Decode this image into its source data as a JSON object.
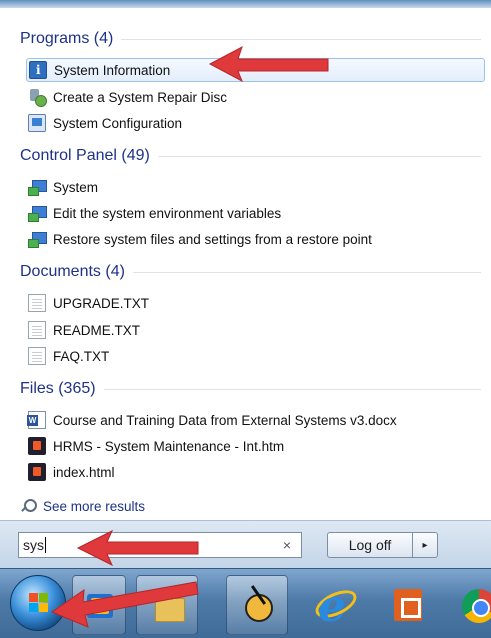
{
  "groups": {
    "programs": {
      "header": "Programs (4)",
      "items": [
        {
          "label": "System Information",
          "icon": "system-information-icon"
        },
        {
          "label": "Create a System Repair Disc",
          "icon": "repair-disc-icon"
        },
        {
          "label": "System Configuration",
          "icon": "system-configuration-icon"
        }
      ]
    },
    "control_panel": {
      "header": "Control Panel (49)",
      "items": [
        {
          "label": "System",
          "icon": "control-panel-icon"
        },
        {
          "label": "Edit the system environment variables",
          "icon": "control-panel-icon"
        },
        {
          "label": "Restore system files and settings from a restore point",
          "icon": "control-panel-icon"
        }
      ]
    },
    "documents": {
      "header": "Documents (4)",
      "items": [
        {
          "label": "UPGRADE.TXT",
          "icon": "text-file-icon"
        },
        {
          "label": "README.TXT",
          "icon": "text-file-icon"
        },
        {
          "label": "FAQ.TXT",
          "icon": "text-file-icon"
        }
      ]
    },
    "files": {
      "header": "Files (365)",
      "items": [
        {
          "label": "Course and Training Data from External Systems v3.docx",
          "icon": "word-document-icon"
        },
        {
          "label": "HRMS - System Maintenance - Int.htm",
          "icon": "html-file-icon"
        },
        {
          "label": "index.html",
          "icon": "html-file-icon"
        }
      ]
    }
  },
  "see_more": "See more results",
  "search": {
    "value": "sys",
    "clear": "×"
  },
  "logoff": {
    "label": "Log off",
    "arrow": "▸"
  },
  "colors": {
    "header_text": "#1e3287",
    "selection_border": "#9dc2ea",
    "annotation_arrow": "#e0393b",
    "taskbar": "#4e7aa8"
  }
}
